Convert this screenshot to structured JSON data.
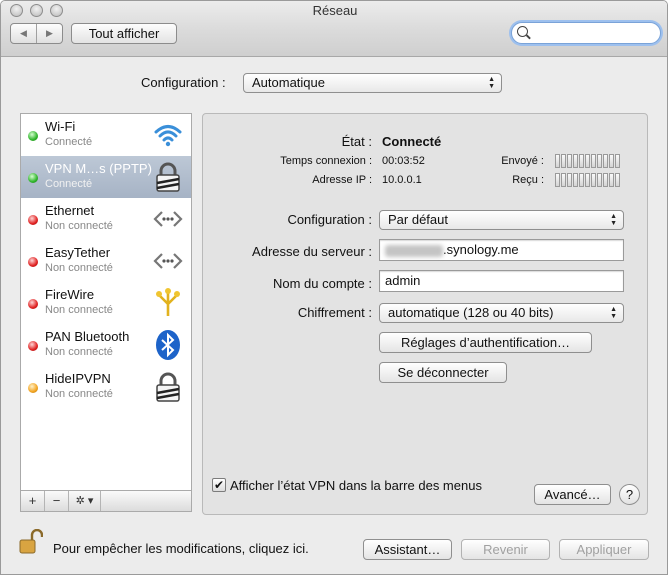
{
  "window": {
    "title": "Réseau"
  },
  "toolbar": {
    "back_glyph": "◀",
    "forward_glyph": "▶",
    "show_all_label": "Tout afficher",
    "search_value": ""
  },
  "location": {
    "label": "Configuration :",
    "value": "Automatique"
  },
  "services": [
    {
      "name": "Wi-Fi",
      "status": "Connecté",
      "status_color": "green",
      "icon": "wifi-icon"
    },
    {
      "name": "VPN M…s (PPTP)",
      "status": "Connecté",
      "status_color": "green",
      "icon": "lock-icon",
      "selected": true
    },
    {
      "name": "Ethernet",
      "status": "Non connecté",
      "status_color": "red",
      "icon": "ethernet-icon"
    },
    {
      "name": "EasyTether",
      "status": "Non connecté",
      "status_color": "red",
      "icon": "ethernet-icon"
    },
    {
      "name": "FireWire",
      "status": "Non connecté",
      "status_color": "red",
      "icon": "firewire-icon"
    },
    {
      "name": "PAN Bluetooth",
      "status": "Non connecté",
      "status_color": "red",
      "icon": "bluetooth-icon"
    },
    {
      "name": "HideIPVPN",
      "status": "Non connecté",
      "status_color": "orange",
      "icon": "lock-icon"
    }
  ],
  "sidebar_actions": {
    "add": "+",
    "remove": "−",
    "gear": "✲ ▾"
  },
  "detail": {
    "status_label": "État :",
    "status_value": "Connecté",
    "connect_time_label": "Temps connexion :",
    "connect_time_value": "00:03:52",
    "ip_label": "Adresse IP :",
    "ip_value": "10.0.0.1",
    "sent_label": "Envoyé :",
    "received_label": "Reçu :",
    "configuration_label": "Configuration :",
    "configuration_value": "Par défaut",
    "server_label": "Adresse du serveur :",
    "server_value": ".synology.me",
    "account_label": "Nom du compte :",
    "account_value": "admin",
    "encryption_label": "Chiffrement :",
    "encryption_value": "automatique (128 ou 40 bits)",
    "auth_button": "Réglages d’authentification…",
    "disconnect_button": "Se déconnecter",
    "show_vpn_label": "Afficher l’état VPN dans la barre des menus",
    "show_vpn_checked": true,
    "advanced_button": "Avancé…",
    "help_button": "?"
  },
  "footer": {
    "lock_text": "Pour empêcher les modifications, cliquez ici.",
    "assistant_button": "Assistant…",
    "revert_button": "Revenir",
    "apply_button": "Appliquer"
  }
}
